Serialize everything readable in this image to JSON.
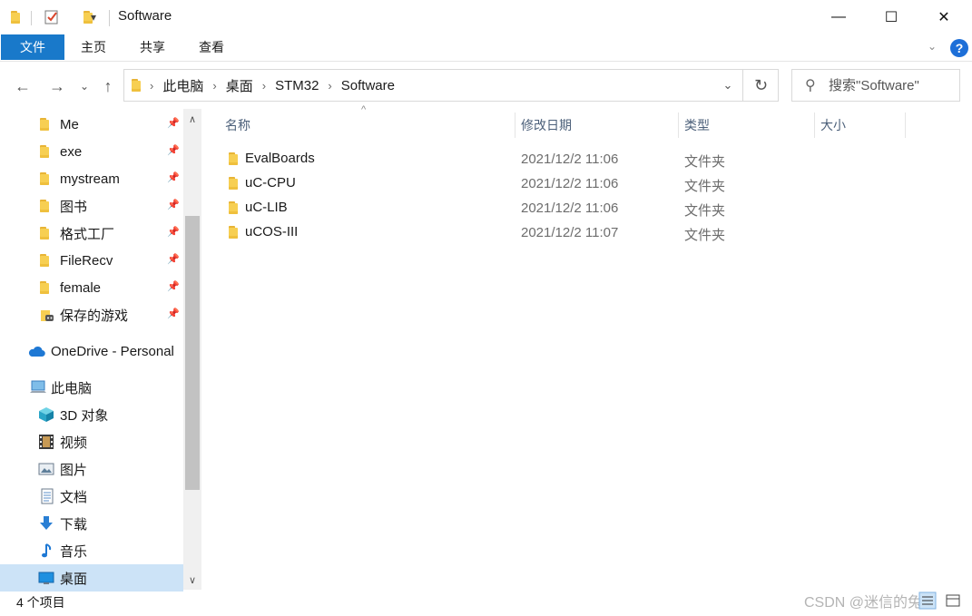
{
  "window": {
    "title": "Software",
    "qa_dropdown": "▾",
    "minimize": "—",
    "maximize": "☐",
    "close": "✕"
  },
  "ribbon": {
    "tabs": [
      "文件",
      "主页",
      "共享",
      "查看"
    ],
    "collapse": "⌄",
    "help": "?"
  },
  "nav": {
    "back": "←",
    "forward": "→",
    "recent": "⌄",
    "up": "↑"
  },
  "address": {
    "crumbs": [
      "此电脑",
      "桌面",
      "STM32",
      "Software"
    ],
    "separator": "›",
    "dropdown": "⌄",
    "refresh": "↻"
  },
  "search": {
    "placeholder": "搜索\"Software\"",
    "icon": "⚲"
  },
  "sidebar": {
    "items": [
      {
        "label": "Me",
        "icon": "folder-icon",
        "pinned": true
      },
      {
        "label": "exe",
        "icon": "folder-icon",
        "pinned": true
      },
      {
        "label": "mystream",
        "icon": "folder-icon",
        "pinned": true
      },
      {
        "label": "图书",
        "icon": "folder-icon",
        "pinned": true
      },
      {
        "label": "格式工厂",
        "icon": "folder-icon",
        "pinned": true
      },
      {
        "label": "FileRecv",
        "icon": "folder-icon",
        "pinned": true
      },
      {
        "label": "female",
        "icon": "folder-icon",
        "pinned": true
      },
      {
        "label": "保存的游戏",
        "icon": "saved-games-icon",
        "pinned": true
      },
      {
        "label": "OneDrive - Personal",
        "icon": "onedrive-icon",
        "pinned": false
      },
      {
        "label": "此电脑",
        "icon": "computer-icon",
        "pinned": false
      },
      {
        "label": "3D 对象",
        "icon": "3d-objects-icon",
        "pinned": false
      },
      {
        "label": "视频",
        "icon": "video-icon",
        "pinned": false
      },
      {
        "label": "图片",
        "icon": "pictures-icon",
        "pinned": false
      },
      {
        "label": "文档",
        "icon": "documents-icon",
        "pinned": false
      },
      {
        "label": "下载",
        "icon": "download-icon",
        "pinned": false
      },
      {
        "label": "音乐",
        "icon": "music-icon",
        "pinned": false
      },
      {
        "label": "桌面",
        "icon": "desktop-icon",
        "pinned": false,
        "selected": true
      }
    ],
    "pin_glyph": "📌",
    "scroll_up": "∧",
    "scroll_down": "∨"
  },
  "columns": {
    "name": "名称",
    "modified": "修改日期",
    "type": "类型",
    "size": "大小",
    "sort_glyph": "^"
  },
  "files": [
    {
      "name": "EvalBoards",
      "modified": "2021/12/2 11:06",
      "type": "文件夹"
    },
    {
      "name": "uC-CPU",
      "modified": "2021/12/2 11:06",
      "type": "文件夹"
    },
    {
      "name": "uC-LIB",
      "modified": "2021/12/2 11:06",
      "type": "文件夹"
    },
    {
      "name": "uCOS-III",
      "modified": "2021/12/2 11:07",
      "type": "文件夹"
    }
  ],
  "status": {
    "count": "4 个项目",
    "watermark": "CSDN @迷信的兔子"
  },
  "colors": {
    "accent": "#1979ca",
    "selected_bg": "#cce3f7",
    "folder": "#f7cf52"
  }
}
